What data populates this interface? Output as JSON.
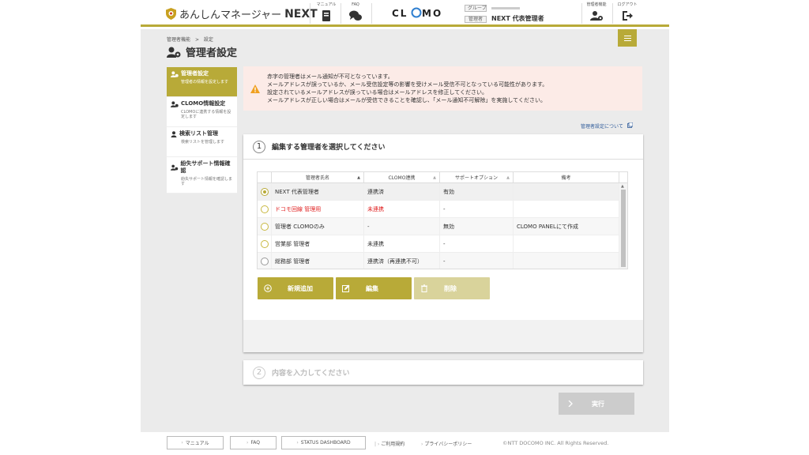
{
  "header": {
    "app_name": "あんしんマネージャー",
    "app_name_suffix": "NEXT",
    "manual_label": "マニュアル",
    "faq_label": "FAQ",
    "group_label": "グループ",
    "role_tag": "管理者",
    "admin_name": "NEXT 代表管理者",
    "admin_func_label": "管理者機能",
    "logout_label": "ログアウト"
  },
  "breadcrumb": {
    "parent": "管理者機能",
    "sep": ">",
    "current": "設定"
  },
  "page_title": "管理者設定",
  "sidebar": {
    "items": [
      {
        "title": "管理者設定",
        "desc": "管理者の情報を設定します"
      },
      {
        "title": "CLOMO情報設定",
        "desc": "CLOMOに連携する情報を設定します"
      },
      {
        "title": "検索リスト管理",
        "desc": "検索リストを管理します"
      },
      {
        "title": "紛失サポート情報確認",
        "desc": "紛失サポート情報を確認します"
      }
    ]
  },
  "alert": {
    "lines": [
      "赤字の管理者はメール通知が不可となっています。",
      "メールアドレスが誤っているか、メール受信設定等の影響を受けメール受信不可となっている可能性があります。",
      "設定されているメールアドレスが誤っている場合はメールアドレスを修正してください。",
      "メールアドレスが正しい場合はメールが受信できることを確認し、「メール通知不可解除」を実施してください。"
    ]
  },
  "help_link": "管理者設定について",
  "step1": {
    "number": "1",
    "title": "編集する管理者を選択してください",
    "columns": [
      "管理者氏名",
      "CLOMO連携",
      "サポートオプション",
      "備考"
    ],
    "sort_glyphs": [
      "▲",
      "▲",
      "▲"
    ],
    "rows": [
      {
        "name": "NEXT 代表管理者",
        "clomo": "連携済",
        "support": "有効",
        "note": "",
        "warn": false,
        "selected": true
      },
      {
        "name": "ドコモ回線 管理用",
        "clomo": "未連携",
        "support": "-",
        "note": "",
        "warn": true,
        "selected": false
      },
      {
        "name": "管理者 CLOMOのみ",
        "clomo": "-",
        "support": "無効",
        "note": "CLOMO PANELにて作成",
        "warn": false,
        "selected": false
      },
      {
        "name": "営業部 管理者",
        "clomo": "未連携",
        "support": "-",
        "note": "",
        "warn": false,
        "selected": false
      },
      {
        "name": "総務部 管理者",
        "clomo": "連携済（再連携不可）",
        "support": "-",
        "note": "",
        "warn": false,
        "selected": false
      }
    ],
    "buttons": {
      "add": "新規追加",
      "edit": "編集",
      "delete": "削除"
    }
  },
  "step2": {
    "number": "2",
    "title": "内容を入力してください"
  },
  "execute_label": "実行",
  "footer": {
    "manual": "マニュアル",
    "faq": "FAQ",
    "status": "STATUS DASHBOARD",
    "terms": "ご利用規約",
    "privacy": "プライバシーポリシー",
    "copyright": "©NTT DOCOMO INC. All Rights Reserved."
  },
  "colors": {
    "accent": "#b8aa38",
    "warn_text": "#e02020",
    "alert_bg": "#fcebe7",
    "alert_icon": "#f0a020"
  }
}
